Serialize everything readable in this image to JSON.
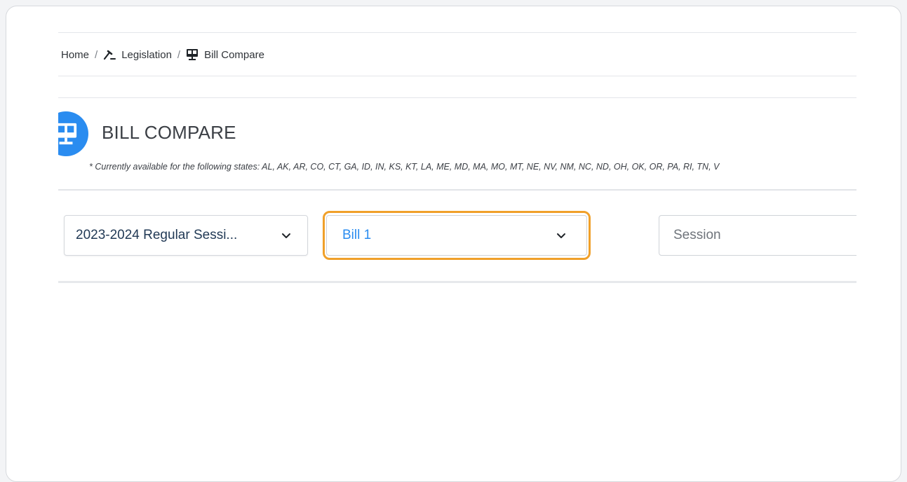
{
  "breadcrumb": {
    "home": "Home",
    "separator": "/",
    "legislation": "Legislation",
    "legislation_icon": "gavel-icon",
    "current": "Bill Compare",
    "current_icon": "bill-compare-icon"
  },
  "header": {
    "title": "BILL COMPARE",
    "icon": "bill-compare-icon",
    "availability_note": "* Currently available for the following states: AL, AK, AR, CO, CT, GA, ID, IN, KS, KT, LA, ME, MD, MA, MO, MT, NE, NV, NM, NC, ND, OH, OK, OR, PA, RI, TN, V"
  },
  "form": {
    "session_select_value": "2023-2024 Regular Sessi...",
    "bill_select_value": "Bill 1",
    "session_input_placeholder": "Session"
  },
  "colors": {
    "accent": "#2a8cf0",
    "highlight": "#f0a02a",
    "title_text": "#3b3f45"
  }
}
